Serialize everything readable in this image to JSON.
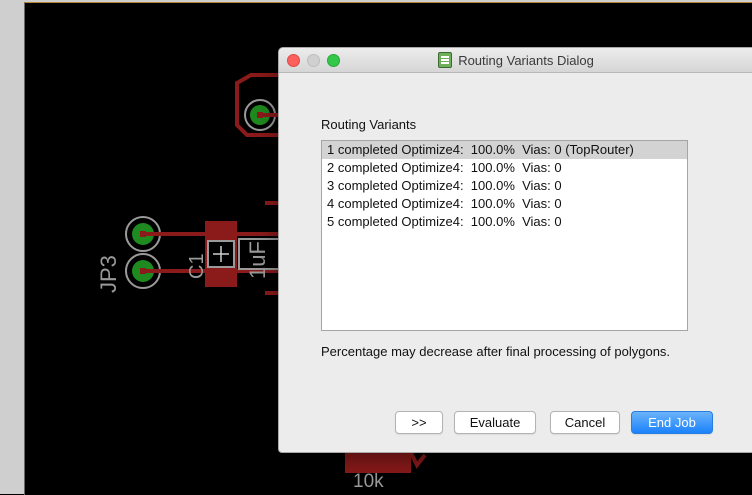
{
  "dialog": {
    "title": "Routing Variants Dialog",
    "section_label": "Routing Variants",
    "variants": [
      "1 completed Optimize4:  100.0%  Vias: 0 (TopRouter)",
      "2 completed Optimize4:  100.0%  Vias: 0",
      "3 completed Optimize4:  100.0%  Vias: 0",
      "4 completed Optimize4:  100.0%  Vias: 0",
      "5 completed Optimize4:  100.0%  Vias: 0"
    ],
    "selected_index": 0,
    "note": "Percentage may decrease after final processing of polygons.",
    "buttons": {
      "more": ">>",
      "evaluate": "Evaluate",
      "cancel": "Cancel",
      "end_job": "End Job"
    }
  },
  "board": {
    "labels": {
      "jp3": "JP3",
      "c1": "C1",
      "c1_value": "1uF",
      "resistor_value": "10k"
    },
    "colors": {
      "background": "#000000",
      "trace": "#8b1a1a",
      "pad": "#1f8a1f",
      "silkscreen": "#9a9a9a",
      "accent_button": "#1a82fb"
    }
  }
}
